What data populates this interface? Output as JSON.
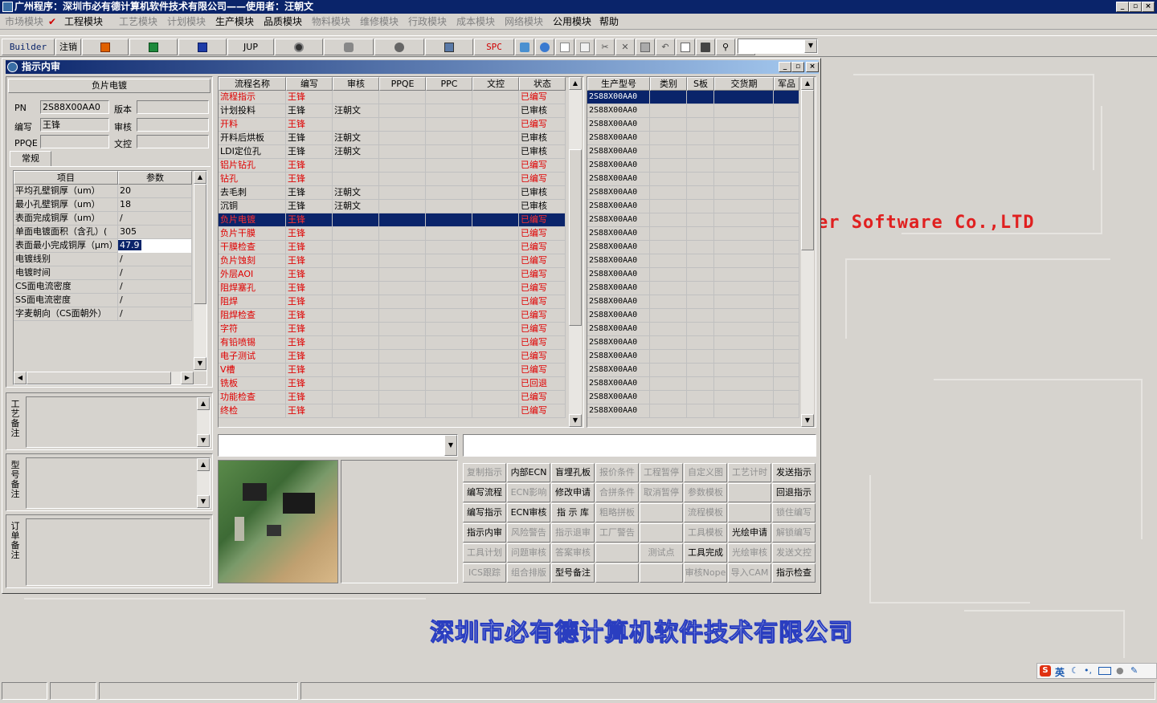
{
  "app": {
    "title": "广州程序：深圳市必有德计算机软件技术有限公司——使用者：汪朝文"
  },
  "menu": [
    "市场模块",
    "工程模块",
    "工艺模块",
    "计划模块",
    "生产模块",
    "品质模块",
    "物料模块",
    "维修模块",
    "行政模块",
    "成本模块",
    "网络模块",
    "公用模块",
    "帮助"
  ],
  "menu_disabled": [
    true,
    false,
    true,
    true,
    false,
    false,
    true,
    true,
    true,
    true,
    true,
    false,
    false
  ],
  "toolbar": {
    "builder": "Builder",
    "logout": "注销",
    "jup": "JUP",
    "spc": "SPC"
  },
  "window": {
    "title": "指示内审"
  },
  "left": {
    "section_title": "负片电镀",
    "pn_label": "PN",
    "pn_value": "2S88X00AA0",
    "version_label": "版本",
    "version_value": "",
    "writer_label": "编写",
    "writer_value": "王锋",
    "audit_label": "审核",
    "audit_value": "",
    "ppqe_label": "PPQE",
    "ppqe_value": "",
    "doc_label": "文控",
    "doc_value": "",
    "tab": "常规",
    "param_headers": [
      "项目",
      "参数"
    ],
    "params": [
      [
        "平均孔壁铜厚（um）",
        "20"
      ],
      [
        "最小孔壁铜厚（um）",
        "18"
      ],
      [
        "表面完成铜厚（um）",
        "/"
      ],
      [
        "单面电镀面积（含孔）(",
        "305"
      ],
      [
        "表面最小完成铜厚（μm）",
        "47.9"
      ],
      [
        "电镀线别",
        "/"
      ],
      [
        "电镀时间",
        "/"
      ],
      [
        "CS面电流密度",
        "/"
      ],
      [
        "SS面电流密度",
        "/"
      ],
      [
        "字麦朝向（CS面朝外）",
        "/"
      ]
    ],
    "note1": "工艺备注",
    "note2": "型号备注",
    "note3": "订单备注"
  },
  "flow": {
    "headers": [
      "流程名称",
      "编写",
      "审核",
      "PPQE",
      "PPC",
      "文控",
      "状态"
    ],
    "rows": [
      [
        "流程指示",
        "王锋",
        "",
        "",
        "",
        "",
        "已编写"
      ],
      [
        "计划投料",
        "王锋",
        "汪朝文",
        "",
        "",
        "",
        "已审核"
      ],
      [
        "开料",
        "王锋",
        "",
        "",
        "",
        "",
        "已编写"
      ],
      [
        "开料后烘板",
        "王锋",
        "汪朝文",
        "",
        "",
        "",
        "已审核"
      ],
      [
        "LDI定位孔",
        "王锋",
        "汪朝文",
        "",
        "",
        "",
        "已审核"
      ],
      [
        "铝片钻孔",
        "王锋",
        "",
        "",
        "",
        "",
        "已编写"
      ],
      [
        "钻孔",
        "王锋",
        "",
        "",
        "",
        "",
        "已编写"
      ],
      [
        "去毛刺",
        "王锋",
        "汪朝文",
        "",
        "",
        "",
        "已审核"
      ],
      [
        "沉铜",
        "王锋",
        "汪朝文",
        "",
        "",
        "",
        "已审核"
      ],
      [
        "负片电镀",
        "王锋",
        "",
        "",
        "",
        "",
        "已编写"
      ],
      [
        "负片干膜",
        "王锋",
        "",
        "",
        "",
        "",
        "已编写"
      ],
      [
        "干膜检查",
        "王锋",
        "",
        "",
        "",
        "",
        "已编写"
      ],
      [
        "负片蚀刻",
        "王锋",
        "",
        "",
        "",
        "",
        "已编写"
      ],
      [
        "外层AOI",
        "王锋",
        "",
        "",
        "",
        "",
        "已编写"
      ],
      [
        "阻焊塞孔",
        "王锋",
        "",
        "",
        "",
        "",
        "已编写"
      ],
      [
        "阻焊",
        "王锋",
        "",
        "",
        "",
        "",
        "已编写"
      ],
      [
        "阻焊检查",
        "王锋",
        "",
        "",
        "",
        "",
        "已编写"
      ],
      [
        "字符",
        "王锋",
        "",
        "",
        "",
        "",
        "已编写"
      ],
      [
        "有铅喷锡",
        "王锋",
        "",
        "",
        "",
        "",
        "已编写"
      ],
      [
        "电子测试",
        "王锋",
        "",
        "",
        "",
        "",
        "已编写"
      ],
      [
        "V槽",
        "王锋",
        "",
        "",
        "",
        "",
        "已编写"
      ],
      [
        "铣板",
        "王锋",
        "",
        "",
        "",
        "",
        "已回退"
      ],
      [
        "功能检查",
        "王锋",
        "",
        "",
        "",
        "",
        "已编写"
      ],
      [
        "终检",
        "王锋",
        "",
        "",
        "",
        "",
        "已编写"
      ]
    ],
    "red_rows": [
      true,
      false,
      true,
      false,
      false,
      true,
      true,
      false,
      false,
      true,
      true,
      true,
      true,
      true,
      true,
      true,
      true,
      true,
      true,
      true,
      true,
      true,
      true,
      true
    ]
  },
  "models": {
    "headers": [
      "生产型号",
      "类别",
      "S板",
      "交货期",
      "军品"
    ],
    "rows": [
      "2S88X00AA0",
      "2S88X00AA0",
      "2S88X00AA0",
      "2S88X00AA0",
      "2S88X00AA0",
      "2S88X00AA0",
      "2S88X00AA0",
      "2S88X00AA0",
      "2S88X00AA0",
      "2S88X00AA0",
      "2S88X00AA0",
      "2S88X00AA0",
      "2S88X00AA0",
      "2S88X00AA0",
      "2S88X00AA0",
      "2S88X00AA0",
      "2S88X00AA0",
      "2S88X00AA0",
      "2S88X00AA0",
      "2S88X00AA0",
      "2S88X00AA0",
      "2S88X00AA0",
      "2S88X00AA0",
      "2S88X00AA0"
    ]
  },
  "actions": [
    [
      [
        "复制指示",
        true
      ],
      [
        "内部ECN",
        false
      ],
      [
        "盲埋孔板",
        false
      ],
      [
        "报价条件",
        true
      ],
      [
        "工程暂停",
        true
      ],
      [
        "自定义图",
        true
      ],
      [
        "工艺计时",
        true
      ],
      [
        "发送指示",
        false
      ]
    ],
    [
      [
        "编写流程",
        false
      ],
      [
        "ECN影响",
        true
      ],
      [
        "修改申请",
        false
      ],
      [
        "合拼条件",
        true
      ],
      [
        "取消暂停",
        true
      ],
      [
        "参数模板",
        true
      ],
      [
        "",
        true
      ],
      [
        "回退指示",
        false
      ]
    ],
    [
      [
        "编写指示",
        false
      ],
      [
        "ECN审核",
        false
      ],
      [
        "指 示 库",
        false
      ],
      [
        "粗略拼板",
        true
      ],
      [
        "",
        true
      ],
      [
        "流程模板",
        true
      ],
      [
        "",
        true
      ],
      [
        "锁住编写",
        true
      ]
    ],
    [
      [
        "指示内审",
        false
      ],
      [
        "风险警告",
        true
      ],
      [
        "指示退审",
        true
      ],
      [
        "工厂警告",
        true
      ],
      [
        "",
        true
      ],
      [
        "工具模板",
        true
      ],
      [
        "光绘申请",
        false
      ],
      [
        "解锁编写",
        true
      ]
    ],
    [
      [
        "工具计划",
        true
      ],
      [
        "问题审核",
        true
      ],
      [
        "答案审核",
        true
      ],
      [
        "",
        true
      ],
      [
        "测试点",
        true
      ],
      [
        "工具完成",
        false
      ],
      [
        "光绘审核",
        true
      ],
      [
        "发送文控",
        true
      ]
    ],
    [
      [
        "ICS跟踪",
        true
      ],
      [
        "组合排版",
        true
      ],
      [
        "型号备注",
        false
      ],
      [
        "",
        true
      ],
      [
        "",
        true
      ],
      [
        "审核Nope",
        true
      ],
      [
        "导入CAM",
        true
      ],
      [
        "指示检查",
        false
      ]
    ]
  ],
  "background": {
    "text1": "er Software Co.,LTD",
    "text2": "深圳市必有德计算机软件技术有限公司"
  },
  "tray": {
    "ime": "英"
  }
}
